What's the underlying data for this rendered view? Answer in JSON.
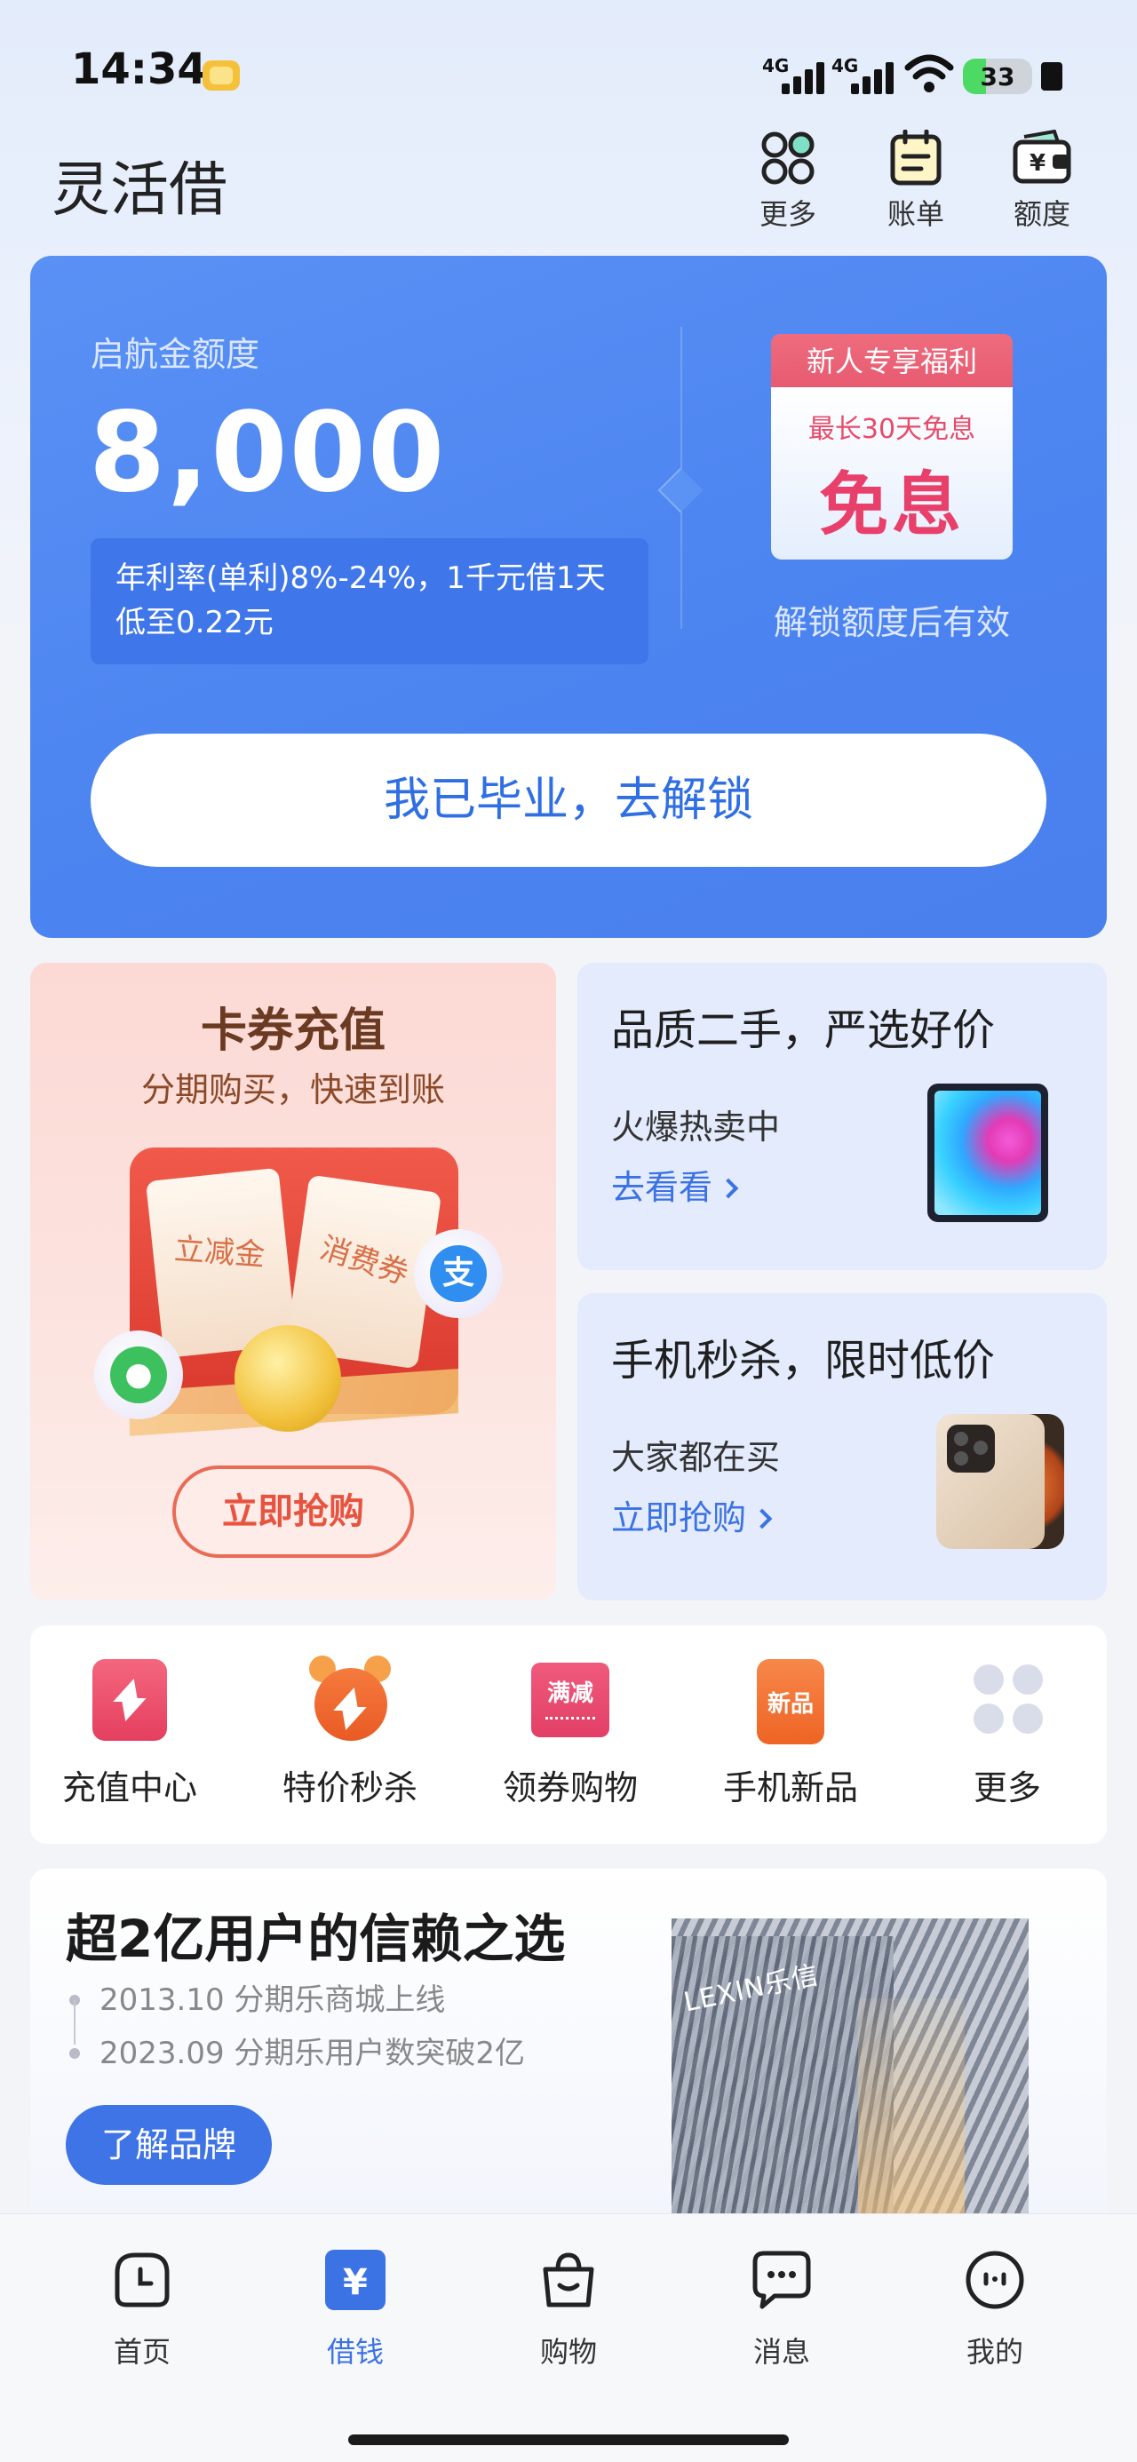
{
  "status_bar": {
    "time": "14:34",
    "net1": "4G",
    "net2": "4G",
    "battery": "33"
  },
  "header": {
    "title": "灵活借",
    "actions": [
      {
        "label": "更多",
        "icon": "grid-icon"
      },
      {
        "label": "账单",
        "icon": "bill-icon"
      },
      {
        "label": "额度",
        "icon": "wallet-icon"
      }
    ]
  },
  "loan_card": {
    "label": "启航金额度",
    "amount": "8,000",
    "rate_text": "年利率(单利)8%-24%，1千元借1天低至0.22元",
    "benefit_tag": "新人专享福利",
    "benefit_sub": "最长30天免息",
    "benefit_main": "免息",
    "benefit_note": "解锁额度后有效",
    "unlock_button": "我已毕业，去解锁"
  },
  "promo_left": {
    "title": "卡券充值",
    "subtitle": "分期购买，快速到账",
    "ticket1": "立减金",
    "ticket2": "消费券",
    "button": "立即抢购"
  },
  "promo_right": [
    {
      "title": "品质二手，严选好价",
      "sub": "火爆热卖中",
      "link": "去看看"
    },
    {
      "title": "手机秒杀，限时低价",
      "sub": "大家都在买",
      "link": "立即抢购"
    }
  ],
  "services": [
    {
      "label": "充值中心",
      "icon": "bolt-icon"
    },
    {
      "label": "特价秒杀",
      "icon": "alarm-clock-icon"
    },
    {
      "label": "领券购物",
      "icon": "coupon-icon",
      "badge": "满减"
    },
    {
      "label": "手机新品",
      "icon": "new-phone-icon",
      "badge": "新品"
    },
    {
      "label": "更多",
      "icon": "more-dots-icon"
    }
  ],
  "brand": {
    "title": "超2亿用户的信赖之选",
    "timeline": [
      "2013.10 分期乐商城上线",
      "2023.09 分期乐用户数突破2亿"
    ],
    "button": "了解品牌",
    "building_logo": "LEXIN乐信"
  },
  "tabbar": [
    {
      "label": "首页",
      "icon": "home-clock-icon",
      "active": false
    },
    {
      "label": "借钱",
      "icon": "yen-icon",
      "active": true
    },
    {
      "label": "购物",
      "icon": "shopping-bag-icon",
      "active": false
    },
    {
      "label": "消息",
      "icon": "chat-bubble-icon",
      "active": false
    },
    {
      "label": "我的",
      "icon": "profile-icon",
      "active": false
    }
  ],
  "colors": {
    "accent": "#3b72e4",
    "card_blue": "#4b83f0",
    "promo_red": "#e8533f"
  }
}
